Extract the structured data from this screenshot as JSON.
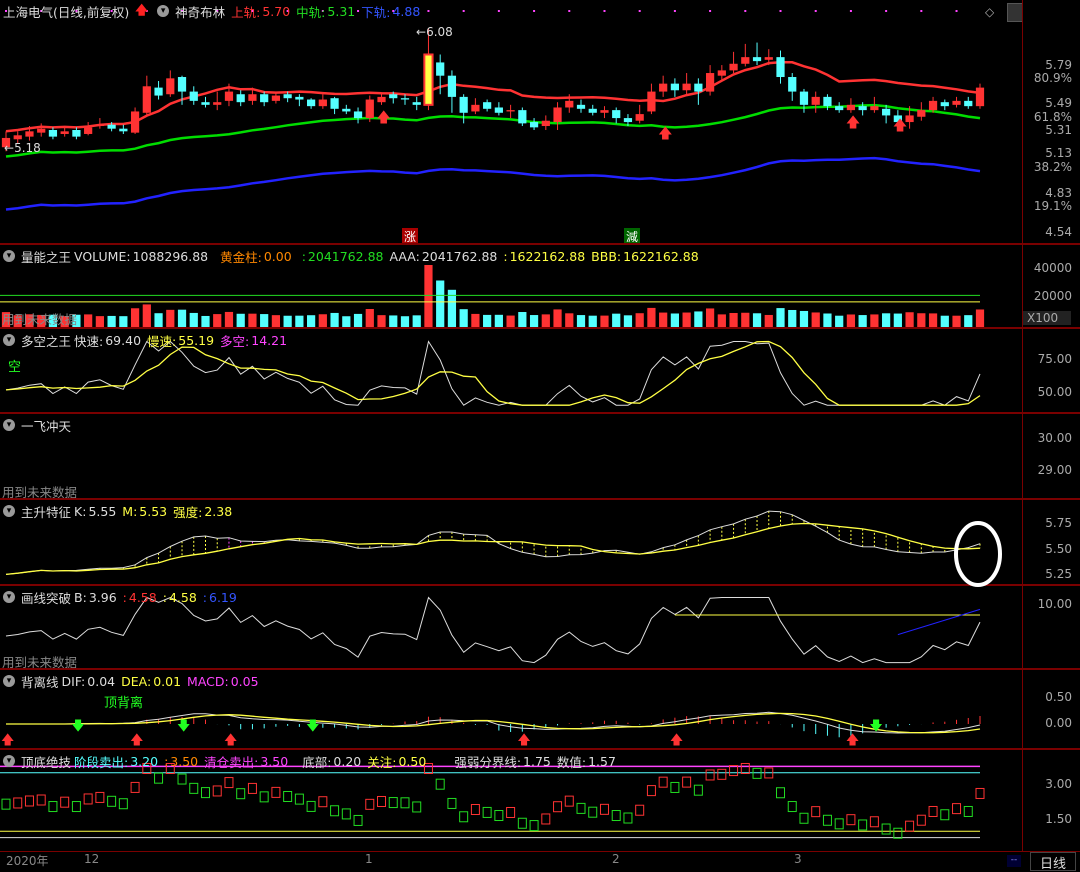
{
  "main": {
    "stock": "上海电气(日线,前复权)",
    "indicator": "神奇布林",
    "upper_label": "上轨:",
    "upper": "5.70",
    "mid_label": "中轨:",
    "mid": "5.31",
    "lower_label": "下轨:",
    "lower": "4.88",
    "high_note": "6.08",
    "low_note": "5.18",
    "yticks": [
      "5.79",
      "80.9%",
      "5.49",
      "61.8%",
      "5.31",
      "5.13",
      "38.2%",
      "4.83",
      "19.1%",
      "4.54"
    ],
    "signal_up": "涨",
    "signal_down": "減"
  },
  "volume": {
    "name": "量能之王",
    "vol_label": "VOLUME:",
    "vol": "1088296.88",
    "gold_label": "黄金柱:",
    "gold": "0.00",
    "a_label": ":",
    "a": "2041762.88",
    "aaa_label": "AAA:",
    "aaa": "2041762.88",
    "b_label": ":",
    "b": "1622162.88",
    "bbb_label": "BBB:",
    "bbb": "1622162.88",
    "yticks": [
      "40000",
      "20000",
      "X100"
    ]
  },
  "duokong": {
    "name": "多空之王",
    "fast_label": "快速:",
    "fast": "69.40",
    "slow_label": "慢速:",
    "slow": "55.19",
    "dk_label": "多空:",
    "dk": "14.21",
    "mark": "空",
    "yticks": [
      "75.00",
      "50.00"
    ]
  },
  "yifei": {
    "name": "一飞冲天",
    "yticks": [
      "30.00",
      "29.00"
    ]
  },
  "zhusheng": {
    "name": "主升特征",
    "k_label": "K:",
    "k": "5.55",
    "m_label": "M:",
    "m": "5.53",
    "q_label": "强度:",
    "q": "2.38",
    "yticks": [
      "5.75",
      "5.50",
      "5.25"
    ]
  },
  "huaxian": {
    "name": "画线突破",
    "b_label": "B:",
    "b": "3.96",
    "v1": "4.58",
    "v2": "4.58",
    "v3": "6.19",
    "sep": ":",
    "yticks": [
      "10.00"
    ]
  },
  "beili": {
    "name": "背离线",
    "dif_label": "DIF:",
    "dif": "0.04",
    "dea_label": "DEA:",
    "dea": "0.01",
    "macd_label": "MACD:",
    "macd": "0.05",
    "note": "顶背离",
    "yticks": [
      "0.50",
      "0.00"
    ]
  },
  "dingdi": {
    "name": "顶底绝技",
    "s1_label": "阶段卖出:",
    "s1": "3.20",
    "s2_label": ":",
    "s2": "3.50",
    "s3_label": "清仓卖出:",
    "s3": "3.50",
    "s4_label": "底部:",
    "s4": "0.20",
    "s5_label": "关注:",
    "s5": "0.50",
    "s6_label": "强弱分界线:",
    "s6": "1.75",
    "s7_label": "数值:",
    "s7": "1.57",
    "yticks": [
      "3.00",
      "1.50"
    ]
  },
  "future_text": "用到未来数据",
  "footer": {
    "year": "2020年",
    "m12": "12",
    "m1": "1",
    "m2": "2",
    "m3": "3",
    "period": "日线",
    "box": "--"
  },
  "colors": {
    "up": "#ff3333",
    "down": "#55ffff",
    "mid": "#00dd00",
    "lower": "#2222ff",
    "yellow": "#ffff44",
    "magenta": "#ff44ff"
  },
  "chart_data": {
    "type": "candlestick",
    "ohlc": [
      [
        5.18,
        5.25,
        5.3,
        5.15
      ],
      [
        5.24,
        5.27,
        5.3,
        5.21
      ],
      [
        5.26,
        5.3,
        5.34,
        5.23
      ],
      [
        5.29,
        5.32,
        5.36,
        5.26
      ],
      [
        5.31,
        5.26,
        5.33,
        5.24
      ],
      [
        5.28,
        5.3,
        5.33,
        5.26
      ],
      [
        5.31,
        5.26,
        5.33,
        5.24
      ],
      [
        5.28,
        5.33,
        5.37,
        5.27
      ],
      [
        5.34,
        5.35,
        5.4,
        5.32
      ],
      [
        5.35,
        5.32,
        5.37,
        5.3
      ],
      [
        5.32,
        5.3,
        5.35,
        5.28
      ],
      [
        5.29,
        5.45,
        5.48,
        5.28
      ],
      [
        5.44,
        5.64,
        5.72,
        5.42
      ],
      [
        5.63,
        5.57,
        5.68,
        5.54
      ],
      [
        5.58,
        5.7,
        5.76,
        5.56
      ],
      [
        5.71,
        5.6,
        5.72,
        5.5
      ],
      [
        5.6,
        5.53,
        5.64,
        5.5
      ],
      [
        5.52,
        5.5,
        5.56,
        5.48
      ],
      [
        5.5,
        5.52,
        5.6,
        5.46
      ],
      [
        5.53,
        5.6,
        5.66,
        5.49
      ],
      [
        5.58,
        5.52,
        5.61,
        5.49
      ],
      [
        5.53,
        5.58,
        5.63,
        5.5
      ],
      [
        5.58,
        5.52,
        5.6,
        5.49
      ],
      [
        5.53,
        5.57,
        5.6,
        5.51
      ],
      [
        5.58,
        5.55,
        5.6,
        5.52
      ],
      [
        5.56,
        5.54,
        5.58,
        5.49
      ],
      [
        5.54,
        5.49,
        5.55,
        5.47
      ],
      [
        5.49,
        5.54,
        5.58,
        5.47
      ],
      [
        5.55,
        5.47,
        5.56,
        5.43
      ],
      [
        5.47,
        5.45,
        5.5,
        5.43
      ],
      [
        5.45,
        5.4,
        5.48,
        5.36
      ],
      [
        5.4,
        5.54,
        5.57,
        5.37
      ],
      [
        5.52,
        5.56,
        5.59,
        5.5
      ],
      [
        5.58,
        5.55,
        5.6,
        5.51
      ],
      [
        5.55,
        5.54,
        5.58,
        5.5
      ],
      [
        5.52,
        5.5,
        5.56,
        5.46
      ],
      [
        5.5,
        5.88,
        6.08,
        5.46
      ],
      [
        5.82,
        5.72,
        5.88,
        5.58
      ],
      [
        5.72,
        5.56,
        5.76,
        5.44
      ],
      [
        5.56,
        5.44,
        5.58,
        5.36
      ],
      [
        5.45,
        5.5,
        5.55,
        5.43
      ],
      [
        5.52,
        5.47,
        5.54,
        5.45
      ],
      [
        5.48,
        5.44,
        5.52,
        5.42
      ],
      [
        5.45,
        5.46,
        5.5,
        5.4
      ],
      [
        5.46,
        5.36,
        5.48,
        5.34
      ],
      [
        5.37,
        5.33,
        5.4,
        5.31
      ],
      [
        5.34,
        5.38,
        5.42,
        5.31
      ],
      [
        5.37,
        5.48,
        5.52,
        5.31
      ],
      [
        5.48,
        5.53,
        5.58,
        5.44
      ],
      [
        5.5,
        5.47,
        5.54,
        5.44
      ],
      [
        5.47,
        5.44,
        5.5,
        5.42
      ],
      [
        5.44,
        5.46,
        5.49,
        5.4
      ],
      [
        5.46,
        5.4,
        5.48,
        5.36
      ],
      [
        5.4,
        5.37,
        5.43,
        5.34
      ],
      [
        5.38,
        5.43,
        5.5,
        5.36
      ],
      [
        5.45,
        5.6,
        5.66,
        5.43
      ],
      [
        5.6,
        5.66,
        5.72,
        5.56
      ],
      [
        5.66,
        5.61,
        5.7,
        5.56
      ],
      [
        5.61,
        5.66,
        5.74,
        5.57
      ],
      [
        5.66,
        5.6,
        5.7,
        5.5
      ],
      [
        5.6,
        5.74,
        5.8,
        5.57
      ],
      [
        5.72,
        5.76,
        5.8,
        5.68
      ],
      [
        5.76,
        5.81,
        5.9,
        5.74
      ],
      [
        5.81,
        5.86,
        5.96,
        5.79
      ],
      [
        5.86,
        5.83,
        5.97,
        5.8
      ],
      [
        5.84,
        5.86,
        5.92,
        5.8
      ],
      [
        5.86,
        5.71,
        5.91,
        5.66
      ],
      [
        5.71,
        5.6,
        5.74,
        5.53
      ],
      [
        5.6,
        5.5,
        5.62,
        5.44
      ],
      [
        5.5,
        5.56,
        5.6,
        5.44
      ],
      [
        5.56,
        5.49,
        5.58,
        5.46
      ],
      [
        5.49,
        5.46,
        5.52,
        5.44
      ],
      [
        5.46,
        5.5,
        5.55,
        5.44
      ],
      [
        5.49,
        5.46,
        5.52,
        5.42
      ],
      [
        5.46,
        5.49,
        5.56,
        5.44
      ],
      [
        5.47,
        5.42,
        5.5,
        5.36
      ],
      [
        5.42,
        5.37,
        5.46,
        5.33
      ],
      [
        5.37,
        5.42,
        5.49,
        5.32
      ],
      [
        5.41,
        5.46,
        5.52,
        5.38
      ],
      [
        5.46,
        5.53,
        5.56,
        5.44
      ],
      [
        5.52,
        5.49,
        5.54,
        5.46
      ],
      [
        5.5,
        5.53,
        5.56,
        5.48
      ],
      [
        5.53,
        5.49,
        5.56,
        5.47
      ],
      [
        5.49,
        5.63,
        5.66,
        5.47
      ]
    ]
  }
}
